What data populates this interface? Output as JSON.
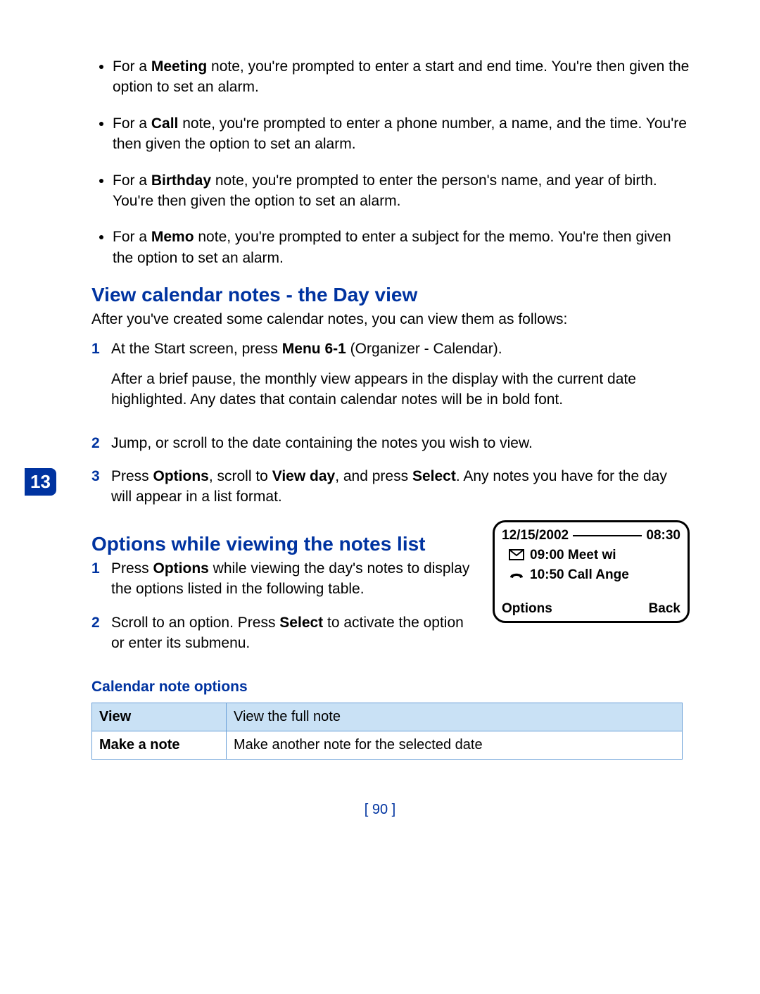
{
  "chapter": "13",
  "bullets": [
    {
      "type": "Meeting",
      "text": " note, you're prompted to enter a start and end time. You're then given the option to set an alarm."
    },
    {
      "type": "Call",
      "text": " note, you're prompted to enter a phone number, a name, and the time. You're then given the option to set an alarm."
    },
    {
      "type": "Birthday",
      "text": " note, you're prompted to enter the person's name, and year of birth. You're then given the option to set an alarm."
    },
    {
      "type": "Memo",
      "text": " note, you're prompted to enter a subject for the memo. You're then given the option to set an alarm."
    }
  ],
  "section1": {
    "title": "View calendar notes - the Day view",
    "intro": "After you've created some calendar notes, you can view them as follows:",
    "steps": [
      {
        "n": "1",
        "lead": "At the Start screen, press ",
        "bold1": "Menu 6-1",
        "tail": " (Organizer - Calendar).",
        "para2": "After a brief pause, the monthly view appears in the display with the current date highlighted. Any dates that contain calendar notes will be in bold font."
      },
      {
        "n": "2",
        "plain": "Jump, or scroll to the date containing the notes you wish to view."
      },
      {
        "n": "3",
        "mix_preA": "Press ",
        "mix_b1": "Options",
        "mix_midA": ", scroll to ",
        "mix_b2": "View day",
        "mix_midB": ", and press ",
        "mix_b3": "Select",
        "mix_tail": ". Any notes you have for the day will appear in a list format."
      }
    ]
  },
  "section2": {
    "title": "Options while viewing the notes list",
    "steps": [
      {
        "n": "1",
        "pre": "Press ",
        "b1": "Options",
        "tail": " while viewing the day's notes to display the options listed in the following table."
      },
      {
        "n": "2",
        "pre": "Scroll to an option. Press ",
        "b1": "Select",
        "tail": " to activate the option or enter its submenu."
      }
    ]
  },
  "phone": {
    "date": "12/15/2002",
    "time": "08:30",
    "line1": "09:00 Meet wi",
    "line2": "10:50 Call Ange",
    "leftkey": "Options",
    "rightkey": "Back"
  },
  "table": {
    "title": "Calendar note options",
    "rows": [
      {
        "k": "View",
        "v": "View the full note",
        "highlight": true
      },
      {
        "k": "Make a note",
        "v": "Make another note for the selected date",
        "highlight": false
      }
    ]
  },
  "pagenum": "[ 90 ]"
}
